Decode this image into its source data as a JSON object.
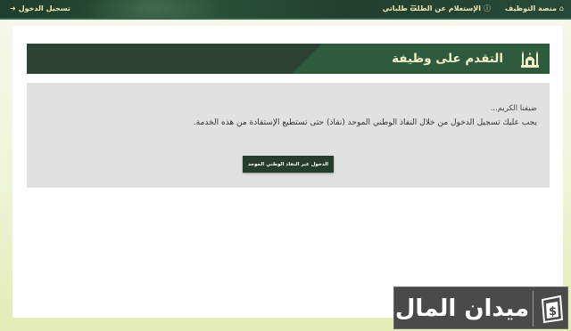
{
  "topbar": {
    "home_label": "منصة التوظيف",
    "inquiry_label": "الإستعلام عن الطلب",
    "requests_label": "طلباتي",
    "login_label": "تسجيل الدخول",
    "icons": {
      "home": "home-icon",
      "inquiry": "info-icon",
      "requests": "list-icon",
      "login": "sign-in-icon"
    },
    "colors": {
      "background": "#2b5239",
      "text": "#f1e9b8"
    }
  },
  "section": {
    "title": "التقدم على وظيفة",
    "icon": "mosque-icon",
    "colors": {
      "header_dark": "#2b4234",
      "header_light": "#2e5a3d",
      "title": "#f4eec8"
    }
  },
  "content": {
    "greeting": "ضيفنا الكريم...",
    "message": "يجب عليك تسجيل الدخول من خلال النفاذ الوطني الموحد (نفاذ) حتى تستطيع الإستفادة من هذه الخدمة.",
    "button_label": "الدخول عبر النفاذ الوطني الموحد",
    "colors": {
      "box": "#e1e1e1",
      "button": "#243d2e"
    }
  },
  "watermark": {
    "text": "ميدان المال",
    "icon": "money-bag-icon"
  }
}
